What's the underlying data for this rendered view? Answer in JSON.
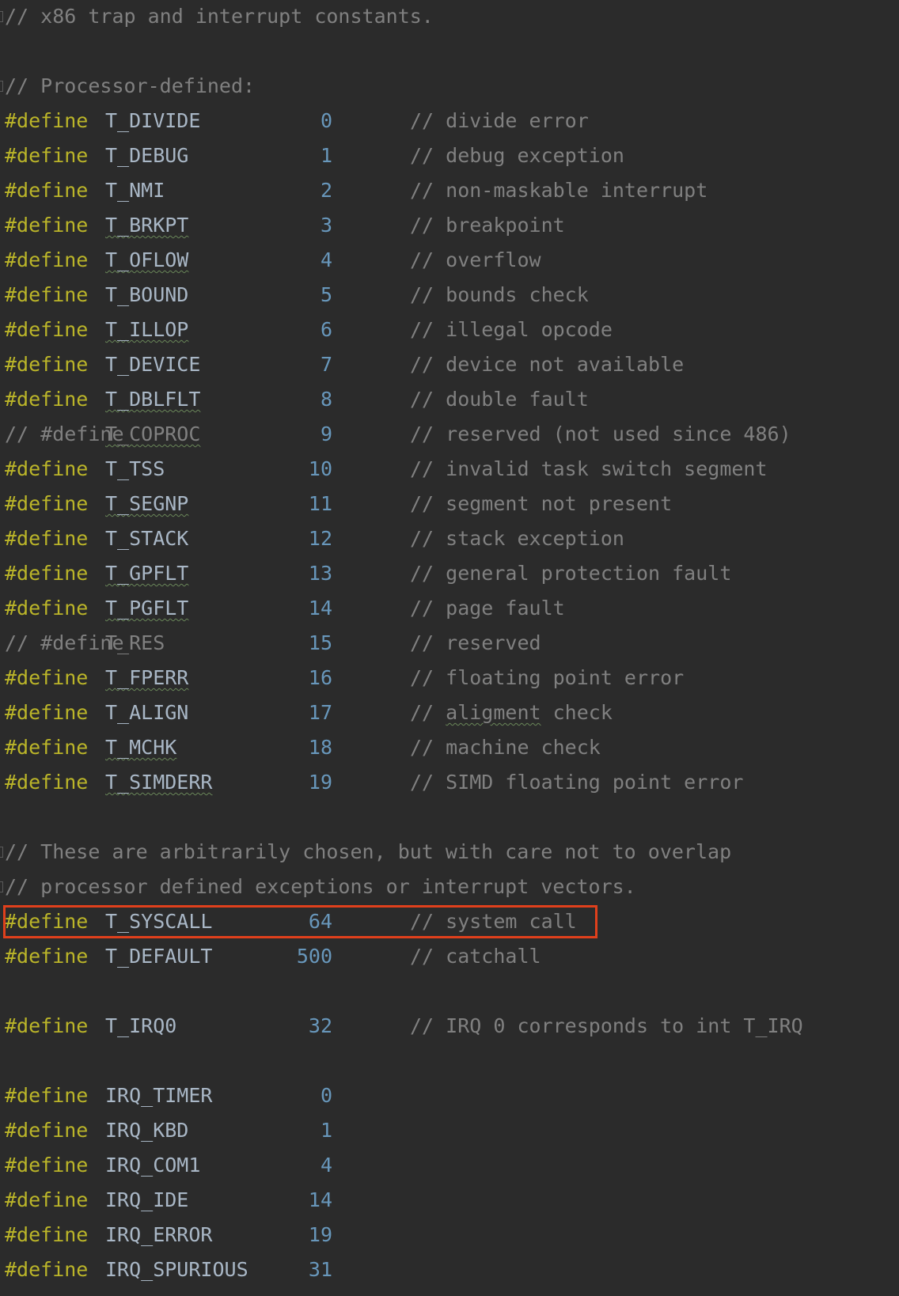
{
  "editor": {
    "header_comment": "// x86 trap and interrupt constants.",
    "section_processor": "// Processor-defined:",
    "section_arbitrary_1": "// These are arbitrarily chosen, but with care not to overlap",
    "section_arbitrary_2": "// processor defined exceptions or interrupt vectors.",
    "define_keyword": "#define",
    "commented_define_prefix": "// #define",
    "processor_defines": [
      {
        "name": "T_DIVIDE",
        "value": "0",
        "comment": "// divide error",
        "commented_out": false
      },
      {
        "name": "T_DEBUG",
        "value": "1",
        "comment": "// debug exception",
        "commented_out": false
      },
      {
        "name": "T_NMI",
        "value": "2",
        "comment": "// non-maskable interrupt",
        "commented_out": false
      },
      {
        "name": "T_BRKPT",
        "value": "3",
        "comment": "// breakpoint",
        "commented_out": false
      },
      {
        "name": "T_OFLOW",
        "value": "4",
        "comment": "// overflow",
        "commented_out": false
      },
      {
        "name": "T_BOUND",
        "value": "5",
        "comment": "// bounds check",
        "commented_out": false
      },
      {
        "name": "T_ILLOP",
        "value": "6",
        "comment": "// illegal opcode",
        "commented_out": false
      },
      {
        "name": "T_DEVICE",
        "value": "7",
        "comment": "// device not available",
        "commented_out": false
      },
      {
        "name": "T_DBLFLT",
        "value": "8",
        "comment": "// double fault",
        "commented_out": false
      },
      {
        "name": "T_COPROC",
        "value": "9",
        "comment": "// reserved (not used since 486)",
        "commented_out": true
      },
      {
        "name": "T_TSS",
        "value": "10",
        "comment": "// invalid task switch segment",
        "commented_out": false
      },
      {
        "name": "T_SEGNP",
        "value": "11",
        "comment": "// segment not present",
        "commented_out": false
      },
      {
        "name": "T_STACK",
        "value": "12",
        "comment": "// stack exception",
        "commented_out": false
      },
      {
        "name": "T_GPFLT",
        "value": "13",
        "comment": "// general protection fault",
        "commented_out": false
      },
      {
        "name": "T_PGFLT",
        "value": "14",
        "comment": "// page fault",
        "commented_out": false
      },
      {
        "name": "T_RES",
        "value": "15",
        "comment": "// reserved",
        "commented_out": true
      },
      {
        "name": "T_FPERR",
        "value": "16",
        "comment": "// floating point error",
        "commented_out": false
      },
      {
        "name": "T_ALIGN",
        "value": "17",
        "comment": "// aligment check",
        "commented_out": false
      },
      {
        "name": "T_MCHK",
        "value": "18",
        "comment": "// machine check",
        "commented_out": false
      },
      {
        "name": "T_SIMDERR",
        "value": "19",
        "comment": "// SIMD floating point error",
        "commented_out": false
      }
    ],
    "syscall_define": {
      "name": "T_SYSCALL",
      "value": "64",
      "comment": "// system call"
    },
    "default_define": {
      "name": "T_DEFAULT",
      "value": "500",
      "comment": "// catchall"
    },
    "irq0_define": {
      "name": "T_IRQ0",
      "value": "32",
      "comment": "// IRQ 0 corresponds to int T_IRQ"
    },
    "irq_defines": [
      {
        "name": "IRQ_TIMER",
        "value": "0"
      },
      {
        "name": "IRQ_KBD",
        "value": "1"
      },
      {
        "name": "IRQ_COM1",
        "value": "4"
      },
      {
        "name": "IRQ_IDE",
        "value": "14"
      },
      {
        "name": "IRQ_ERROR",
        "value": "19"
      },
      {
        "name": "IRQ_SPURIOUS",
        "value": "31"
      }
    ],
    "colors": {
      "background": "#2b2b2b",
      "keyword": "#bbb529",
      "identifier": "#a9b7c6",
      "number": "#6897bb",
      "comment": "#808080",
      "highlight_box": "#e0401c"
    }
  }
}
